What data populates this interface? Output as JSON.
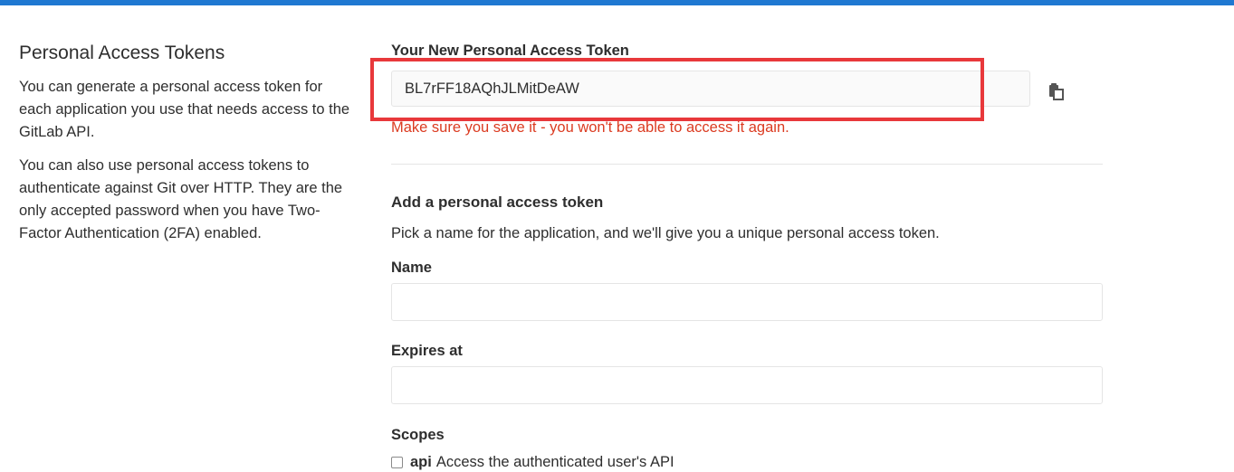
{
  "accent_color": "#1f78d1",
  "error_color": "#db3b21",
  "highlight_color": "#e8383b",
  "sidebar": {
    "title": "Personal Access Tokens",
    "paragraphs": [
      "You can generate a personal access token for each application you use that needs access to the GitLab API.",
      "You can also use personal access tokens to authenticate against Git over HTTP. They are the only accepted password when you have Two-Factor Authentication (2FA) enabled."
    ]
  },
  "new_token": {
    "label": "Your New Personal Access Token",
    "value": "BL7rFF18AQhJLMitDeAW",
    "copy_icon": "clipboard-icon",
    "warning": "Make sure you save it - you won't be able to access it again."
  },
  "add_token": {
    "title": "Add a personal access token",
    "description": "Pick a name for the application, and we'll give you a unique personal access token.",
    "name_label": "Name",
    "name_value": "",
    "expires_label": "Expires at",
    "expires_value": "",
    "scopes_label": "Scopes",
    "scopes": [
      {
        "name": "api",
        "description": "Access the authenticated user's API",
        "checked": false
      }
    ]
  }
}
